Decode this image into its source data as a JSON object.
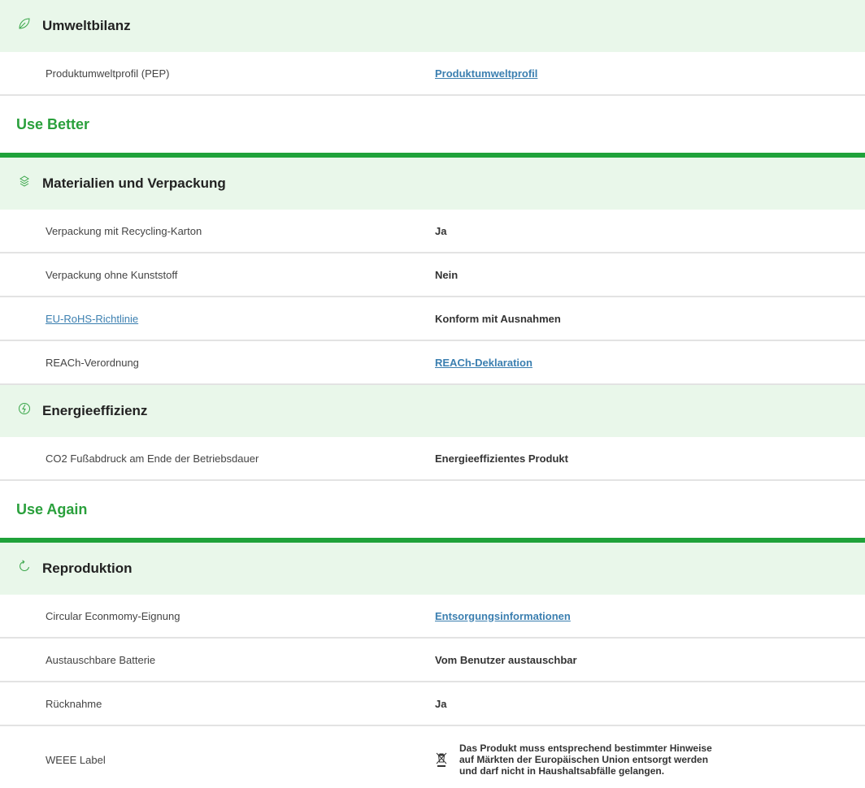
{
  "sections": {
    "umweltbilanz": {
      "title": "Umweltbilanz",
      "icon": "leaf-icon",
      "rows": [
        {
          "label": "Produktumweltprofil (PEP)",
          "value": "Produktumweltprofil"
        }
      ]
    },
    "use_better": {
      "title": "Use Better"
    },
    "materialien": {
      "title": "Materialien und Verpackung",
      "icon": "layers-icon",
      "rows": [
        {
          "label": "Verpackung mit Recycling-Karton",
          "value": "Ja"
        },
        {
          "label": "Verpackung ohne Kunststoff",
          "value": "Nein"
        },
        {
          "label": "EU-RoHS-Richtlinie",
          "value": "Konform mit Ausnahmen"
        },
        {
          "label": "REACh-Verordnung",
          "value": "REACh-Deklaration"
        }
      ]
    },
    "energie": {
      "title": "Energieeffizienz",
      "icon": "energy-icon",
      "rows": [
        {
          "label": "CO2 Fußabdruck am Ende der Betriebsdauer",
          "value": "Energieeffizientes Produkt"
        }
      ]
    },
    "use_again": {
      "title": "Use Again"
    },
    "reproduktion": {
      "title": "Reproduktion",
      "icon": "cycle-icon",
      "rows": [
        {
          "label": "Circular Econmomy-Eignung",
          "value": "Entsorgungsinformationen"
        },
        {
          "label": "Austauschbare Batterie",
          "value": "Vom Benutzer austauschbar"
        },
        {
          "label": "Rücknahme",
          "value": "Ja"
        },
        {
          "label": "WEEE Label",
          "value_lines": [
            "Das Produkt muss entsprechend bestimmter Hinweise",
            "auf Märkten der Europäischen Union entsorgt werden",
            "und darf nicht in Haushaltsabfälle gelangen."
          ],
          "icon": "crossed-bin-icon"
        }
      ]
    }
  },
  "colors": {
    "header_bg": "#e9f7ea",
    "accent_green": "#1fa23a",
    "link_blue": "#2a6fa0"
  }
}
